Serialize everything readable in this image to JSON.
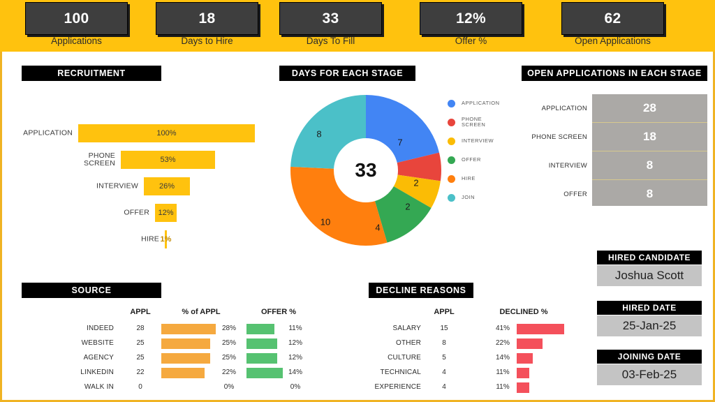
{
  "kpis": [
    {
      "value": "100",
      "label": "Applications"
    },
    {
      "value": "18",
      "label": "Days to Hire"
    },
    {
      "value": "33",
      "label": "Days To Fill"
    },
    {
      "value": "12%",
      "label": "Offer %"
    },
    {
      "value": "62",
      "label": "Open Applications"
    }
  ],
  "sections": {
    "recruitment": "RECRUITMENT",
    "days_for_each_stage": "DAYS FOR EACH STAGE",
    "open_applications_in_each_stage": "OPEN APPLICATIONS IN EACH STAGE",
    "source": "SOURCE",
    "decline_reasons": "DECLINE REASONS"
  },
  "hired_panel": {
    "candidate_title": "HIRED CANDIDATE",
    "candidate_name": "Joshua Scott",
    "hired_date_title": "HIRED DATE",
    "hired_date": "25-Jan-25",
    "joining_date_title": "JOINING DATE",
    "joining_date": "03-Feb-25"
  },
  "colors": {
    "brand_yellow": "#FFC20E",
    "border_yellow": "#F0B323",
    "kpi_box": "#3E3E3E",
    "gray_panel": "#ABA9A6",
    "card_gray": "#C4C4C4",
    "bar_orange": "#F5A93F",
    "bar_green": "#56C271",
    "bar_red": "#F4505B",
    "donut_application": "#4285F4",
    "donut_phone_screen": "#E8453C",
    "donut_interview": "#FBBC05",
    "donut_offer": "#34A853",
    "donut_hire": "#FF7F0E",
    "donut_join": "#4BC0C8"
  },
  "chart_data": [
    {
      "type": "bar",
      "title": "RECRUITMENT",
      "orientation": "funnel",
      "categories": [
        "APPLICATION",
        "PHONE SCREEN",
        "INTERVIEW",
        "OFFER",
        "HIRE"
      ],
      "values": [
        100,
        53,
        26,
        12,
        1
      ],
      "value_labels": [
        "100%",
        "53%",
        "26%",
        "12%",
        "1%"
      ],
      "xlabel": "",
      "ylabel": "",
      "ylim": [
        0,
        100
      ],
      "grid": false,
      "legend": "none",
      "color": "#FFC20E"
    },
    {
      "type": "pie",
      "subtype": "donut",
      "title": "DAYS FOR EACH STAGE",
      "center_label": "33",
      "categories": [
        "APPLICATION",
        "PHONE SCREEN",
        "INTERVIEW",
        "OFFER",
        "HIRE",
        "JOIN"
      ],
      "values": [
        7,
        2,
        2,
        4,
        10,
        8
      ],
      "total": 33,
      "colors": [
        "#4285F4",
        "#E8453C",
        "#FBBC05",
        "#34A853",
        "#FF7F0E",
        "#4BC0C8"
      ],
      "legend": "right",
      "legend_entries": [
        "APPLICATION",
        "PHONE\nSCREEN",
        "INTERVIEW",
        "OFFER",
        "HIRE",
        "JOIN"
      ]
    },
    {
      "type": "table",
      "title": "OPEN APPLICATIONS IN EACH STAGE",
      "categories": [
        "APPLICATION",
        "PHONE SCREEN",
        "INTERVIEW",
        "OFFER"
      ],
      "values": [
        28,
        18,
        8,
        8
      ]
    },
    {
      "type": "bar",
      "title": "SOURCE",
      "orientation": "horizontal",
      "categories": [
        "INDEED",
        "WEBSITE",
        "AGENCY",
        "LINKEDIN",
        "WALK IN"
      ],
      "columns": [
        "APPL",
        "% of APPL",
        "OFFER %"
      ],
      "series": [
        {
          "name": "APPL",
          "values": [
            28,
            25,
            25,
            22,
            0
          ],
          "labels": [
            "28",
            "25",
            "25",
            "22",
            "0"
          ]
        },
        {
          "name": "% of APPL",
          "values": [
            28,
            25,
            25,
            22,
            0
          ],
          "labels": [
            "28%",
            "25%",
            "25%",
            "22%",
            "0%"
          ],
          "color": "#F5A93F"
        },
        {
          "name": "OFFER %",
          "values": [
            11,
            12,
            12,
            14,
            0
          ],
          "labels": [
            "11%",
            "12%",
            "12%",
            "14%",
            "0%"
          ],
          "color": "#56C271"
        }
      ],
      "ylim": [
        0,
        28
      ],
      "grid": false
    },
    {
      "type": "bar",
      "title": "DECLINE REASONS",
      "orientation": "horizontal",
      "categories": [
        "SALARY",
        "OTHER",
        "CULTURE",
        "TECHNICAL",
        "EXPERIENCE"
      ],
      "columns": [
        "APPL",
        "DECLINED %"
      ],
      "series": [
        {
          "name": "APPL",
          "values": [
            15,
            8,
            5,
            4,
            4
          ],
          "labels": [
            "15",
            "8",
            "5",
            "4",
            "4"
          ]
        },
        {
          "name": "DECLINED %",
          "values": [
            41,
            22,
            14,
            11,
            11
          ],
          "labels": [
            "41%",
            "22%",
            "14%",
            "11%",
            "11%"
          ],
          "color": "#F4505B"
        }
      ],
      "ylim": [
        0,
        41
      ],
      "grid": false
    }
  ]
}
